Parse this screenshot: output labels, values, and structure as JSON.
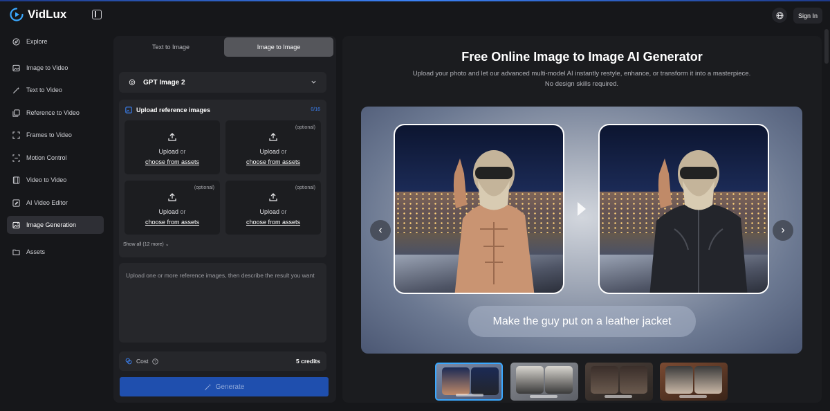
{
  "app": {
    "name": "VidLux",
    "sign_in": "Sign In"
  },
  "sidebar": {
    "items": [
      {
        "label": "Explore",
        "icon": "compass-icon"
      },
      {
        "label": "Image to Video",
        "icon": "image-icon"
      },
      {
        "label": "Text to Video",
        "icon": "wand-icon"
      },
      {
        "label": "Reference to Video",
        "icon": "images-icon"
      },
      {
        "label": "Frames to Video",
        "icon": "frames-icon"
      },
      {
        "label": "Motion Control",
        "icon": "motion-icon"
      },
      {
        "label": "Video to Video",
        "icon": "film-icon"
      },
      {
        "label": "AI Video Editor",
        "icon": "editor-icon"
      },
      {
        "label": "Image Generation",
        "icon": "image-gen-icon",
        "active": true
      },
      {
        "label": "Assets",
        "icon": "folder-icon"
      }
    ]
  },
  "tabs": [
    {
      "label": "Text to Image"
    },
    {
      "label": "Image to Image",
      "active": true
    }
  ],
  "model": {
    "name": "GPT Image 2"
  },
  "upload": {
    "title": "Upload reference images",
    "count": "0/16",
    "upload_text": "Upload",
    "or_text": "or",
    "assets_text": "choose from assets",
    "optional_text": "(optional)",
    "show_all": "Show all (12 more)"
  },
  "prompt": {
    "placeholder": "Upload one or more reference images, then describe the result you want"
  },
  "cost": {
    "label": "Cost",
    "value": "5 credits"
  },
  "generate": {
    "label": "Generate"
  },
  "hero": {
    "title": "Free Online Image to Image AI Generator",
    "subtitle": "Upload your photo and let our advanced multi-model AI instantly restyle, enhance, or transform it into a masterpiece. No design skills required.",
    "caption": "Make the guy put on a leather jacket"
  },
  "colors": {
    "accent": "#3b82f6",
    "generate_bg": "#1f4fae",
    "thumb_active": "#3aa8ff"
  }
}
